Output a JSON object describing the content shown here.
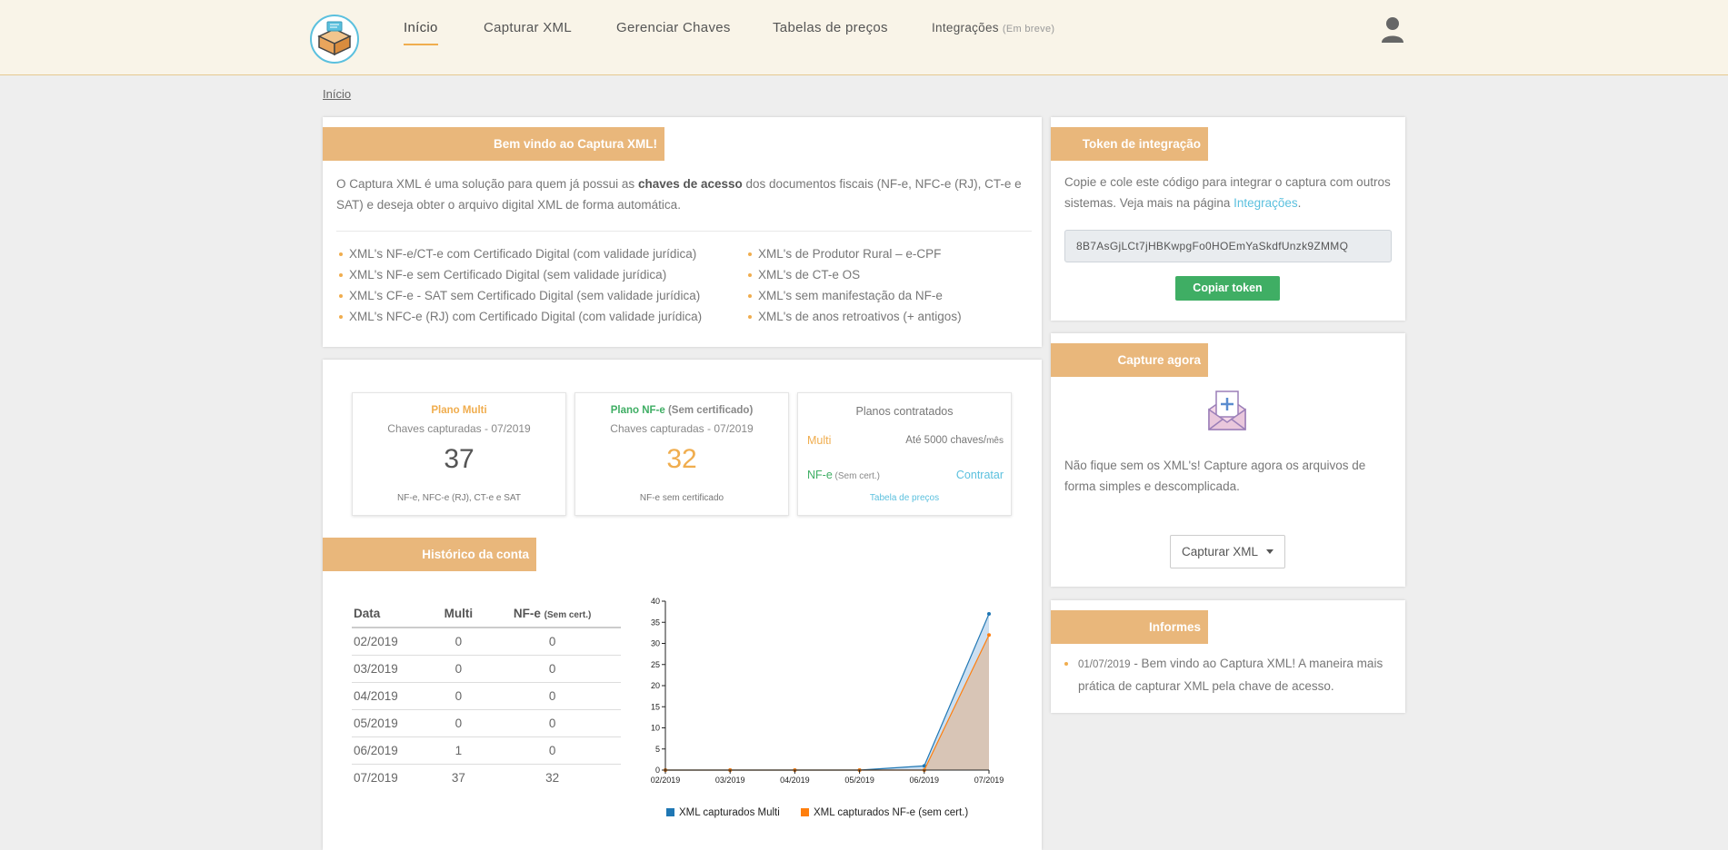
{
  "nav": {
    "items": [
      "Início",
      "Capturar XML",
      "Gerenciar Chaves",
      "Tabelas de preços"
    ],
    "integrations": {
      "label": "Integrações",
      "badge": "(Em breve)"
    }
  },
  "breadcrumb": "Início",
  "welcome": {
    "title": "Bem vindo ao Captura XML!",
    "text_before": "O Captura XML é uma solução para quem já possui as ",
    "text_bold": "chaves de acesso",
    "text_after": " dos documentos fiscais (NF-e, NFC-e (RJ), CT-e e SAT) e deseja obter o arquivo digital XML de forma automática.",
    "features_left": [
      "XML's NF-e/CT-e com Certificado Digital (com validade jurídica)",
      "XML's NF-e sem Certificado Digital (sem validade jurídica)",
      "XML's CF-e - SAT sem Certificado Digital (sem validade jurídica)",
      "XML's NFC-e (RJ) com Certificado Digital (com validade jurídica)"
    ],
    "features_right": [
      "XML's de Produtor Rural – e-CPF",
      "XML's de CT-e OS",
      "XML's sem manifestação da NF-e",
      "XML's de anos retroativos (+ antigos)"
    ]
  },
  "stats": {
    "multi": {
      "title": "Plano Multi",
      "subtitle": "Chaves capturadas - 07/2019",
      "value": "37",
      "footer": "NF-e, NFC-e (RJ), CT-e e SAT"
    },
    "nfe": {
      "title_main": "Plano NF-e",
      "title_sub": " (Sem certificado)",
      "subtitle": "Chaves capturadas - 07/2019",
      "value": "32",
      "footer": "NF-e sem certificado"
    },
    "plans": {
      "title": "Planos contratados",
      "multi_label": "Multi",
      "multi_value": "Até 5000 chaves/",
      "multi_unit": "mês",
      "nfe_label": "NF-e",
      "nfe_sub": " (Sem cert.)",
      "contract": "Contratar",
      "price_table": "Tabela de preços"
    }
  },
  "history": {
    "title": "Histórico da conta",
    "columns": [
      "Data",
      "Multi",
      "NF-e",
      "(Sem cert.)"
    ],
    "rows": [
      [
        "02/2019",
        "0",
        "0"
      ],
      [
        "03/2019",
        "0",
        "0"
      ],
      [
        "04/2019",
        "0",
        "0"
      ],
      [
        "05/2019",
        "0",
        "0"
      ],
      [
        "06/2019",
        "1",
        "0"
      ],
      [
        "07/2019",
        "37",
        "32"
      ]
    ]
  },
  "chart_data": {
    "type": "area",
    "categories": [
      "02/2019",
      "03/2019",
      "04/2019",
      "05/2019",
      "06/2019",
      "07/2019"
    ],
    "series": [
      {
        "name": "XML capturados Multi",
        "values": [
          0,
          0,
          0,
          0,
          1,
          37
        ],
        "color": "#1f77b4"
      },
      {
        "name": "XML capturados NF-e (sem cert.)",
        "values": [
          0,
          0,
          0,
          0,
          0,
          32
        ],
        "color": "#ff7f0e"
      }
    ],
    "ylim": [
      0,
      40
    ],
    "yticks": [
      0,
      5,
      10,
      15,
      20,
      25,
      30,
      35,
      40
    ],
    "legend": "bottom",
    "grid": false
  },
  "token": {
    "title": "Token de integração",
    "text": "Copie e cole este código para integrar o captura com outros sistemas. Veja mais na página ",
    "link": "Integrações",
    "text_end": ".",
    "value": "8B7AsGjLCt7jHBKwpgFo0HOEmYaSkdfUnzk9ZMMQ",
    "button": "Copiar token"
  },
  "capture": {
    "title": "Capture agora",
    "text": "Não fique sem os XML's! Capture agora os arquivos de forma simples e descomplicada.",
    "button": "Capturar XML"
  },
  "news": {
    "title": "Informes",
    "date": "01/07/2019",
    "text": " - Bem vindo ao Captura XML! A maneira mais prática de capturar XML pela chave de acesso."
  },
  "colors": {
    "accent": "#e9b77b",
    "orange": "#f0ad4e",
    "green": "#3fae64",
    "link": "#5bc0de"
  }
}
